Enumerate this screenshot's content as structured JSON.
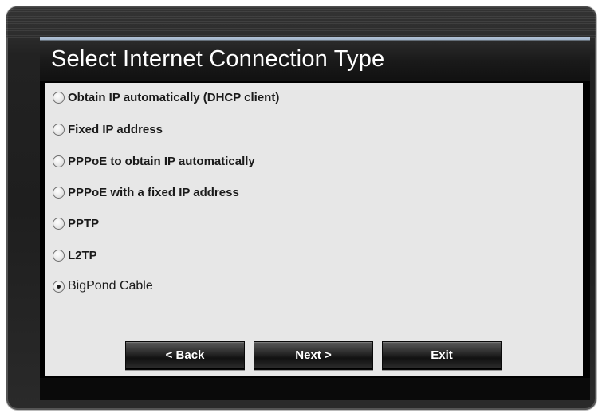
{
  "dialog": {
    "title": "Select Internet Connection Type"
  },
  "options": [
    {
      "label": "Obtain IP automatically (DHCP client)",
      "selected": false
    },
    {
      "label": "Fixed IP address",
      "selected": false
    },
    {
      "label": "PPPoE to obtain IP automatically",
      "selected": false
    },
    {
      "label": "PPPoE with a fixed IP address",
      "selected": false
    },
    {
      "label": "PPTP",
      "selected": false
    },
    {
      "label": "L2TP",
      "selected": false
    },
    {
      "label": "BigPond Cable",
      "selected": true
    }
  ],
  "buttons": {
    "back_label": "< Back",
    "next_label": "Next >",
    "exit_label": "Exit"
  }
}
